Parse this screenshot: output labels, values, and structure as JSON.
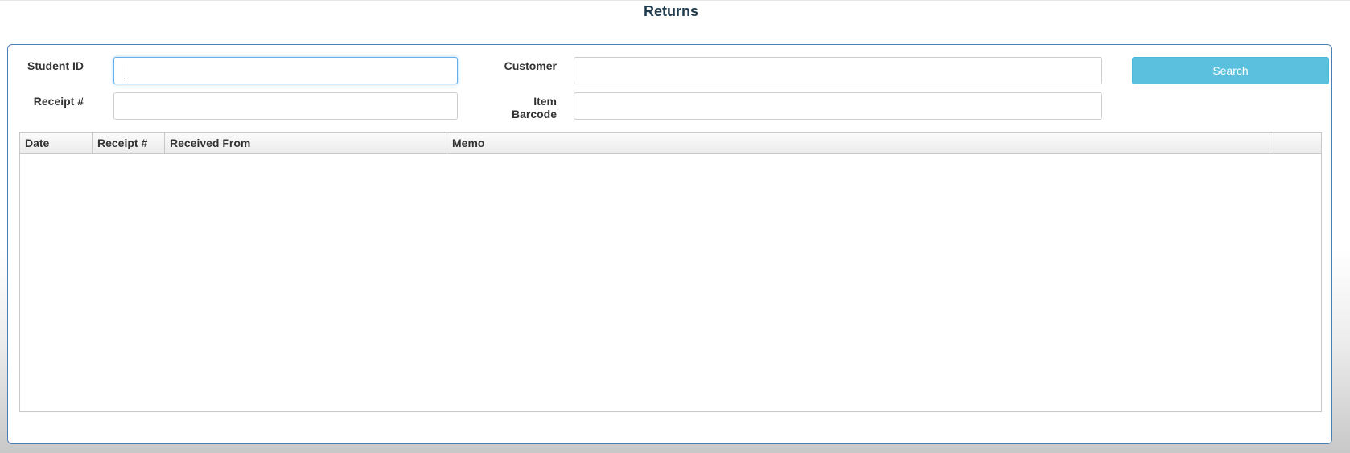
{
  "page": {
    "title": "Returns"
  },
  "filters": {
    "student_id_label": "Student ID",
    "student_id_value": "",
    "receipt_label": "Receipt #",
    "receipt_value": "",
    "customer_label": "Customer",
    "customer_value": "",
    "item_barcode_label_line1": "Item",
    "item_barcode_label_line2": "Barcode",
    "item_barcode_value": "",
    "search_label": "Search"
  },
  "grid": {
    "columns": [
      "Date",
      "Receipt #",
      "Received From",
      "Memo",
      ""
    ],
    "rows": []
  },
  "colors": {
    "title": "#1f3b4d",
    "panel_border": "#4a7eb5",
    "search_button": "#5bc0de",
    "focus_border": "#66afe9"
  }
}
